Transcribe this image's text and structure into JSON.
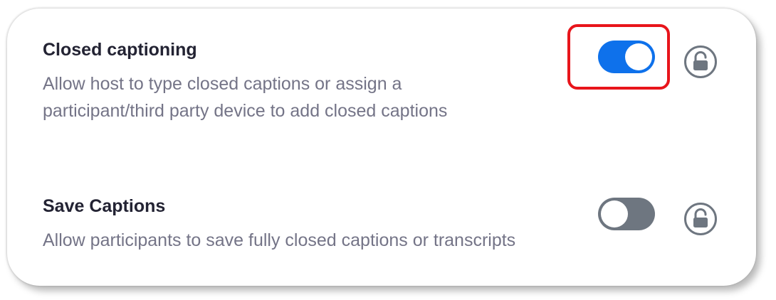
{
  "settings": [
    {
      "title": "Closed captioning",
      "description_lines": [
        "Allow host to type closed captions or assign a",
        "participant/third party device to add closed captions"
      ],
      "toggle_state": "on",
      "highlighted": true
    },
    {
      "title": "Save Captions",
      "description_lines": [
        "Allow participants to save fully closed captions or transcripts"
      ],
      "toggle_state": "off",
      "highlighted": false
    }
  ],
  "colors": {
    "toggle_on": "#0e71eb",
    "toggle_off": "#6e7680",
    "highlight_border": "#e8151b",
    "title_text": "#232333",
    "description_text": "#747487",
    "lock_icon": "#6e7680"
  },
  "icons": {
    "lock": "unlocked-padlock-icon"
  }
}
